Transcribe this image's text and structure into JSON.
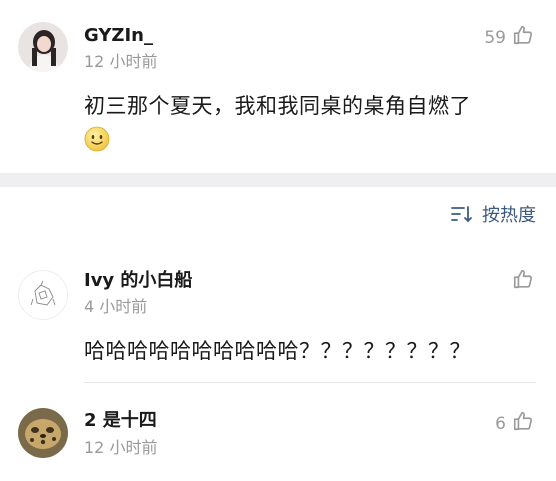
{
  "comments": [
    {
      "username": "GYZIn_",
      "time": "12 小时前",
      "like_count": "59",
      "text": "初三那个夏天，我和我同桌的桌角自燃了",
      "has_emoji": true
    },
    {
      "username": "Ivy 的小白船",
      "time": "4 小时前",
      "like_count": "",
      "text": "哈哈哈哈哈哈哈哈哈哈？？？？？？？？"
    },
    {
      "username": "2 是十四",
      "time": "12 小时前",
      "like_count": "6",
      "text": ""
    }
  ],
  "sort": {
    "label": "按热度"
  },
  "colors": {
    "accent": "#3d5a7e",
    "muted": "#9a9a9a",
    "band": "#efeff2"
  },
  "icons": [
    "thumbs-up-icon",
    "sort-icon",
    "smile-emoji-icon"
  ]
}
